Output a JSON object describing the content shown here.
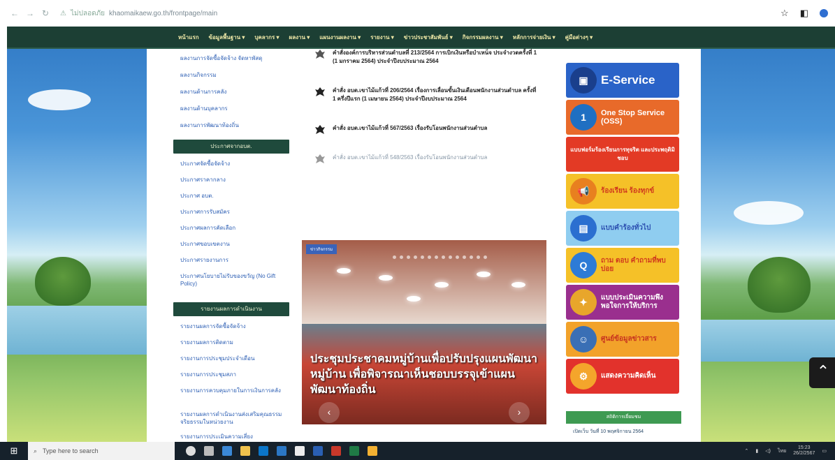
{
  "browser": {
    "back_icon": "back-arrow",
    "forward_icon": "forward-arrow",
    "reload_icon": "reload",
    "security_label": "ไม่ปลอดภัย",
    "url": "khaomaikaew.go.th/frontpage/main",
    "star_icon": "star",
    "extension_icon": "extension",
    "profile_icon": "profile"
  },
  "nav": {
    "items": [
      "หน้าแรก",
      "ข้อมูลพื้นฐาน ▾",
      "บุคลากร ▾",
      "ผลงาน ▾",
      "แผนงานผลงาน ▾",
      "รายงาน ▾",
      "ข่าวประชาสัมพันธ์ ▾",
      "กิจกรรมผลงาน ▾",
      "หลักการจ่ายเงิน ▾",
      "คู่มือต่างๆ ▾"
    ]
  },
  "left": {
    "links_top": [
      "ผลงานการจัดซื้อจัดจ้าง จัดหาพัสดุ",
      "ผลงานกิจกรรม",
      "ผลงานด้านการคลัง",
      "ผลงานด้านบุคลากร",
      "ผลงานการพัฒนาท้องถิ่น"
    ],
    "panel1_title": "ประกาศจากอบต.",
    "panel1_links": [
      "ประกาศจัดซื้อจัดจ้าง",
      "ประกาศราคากลาง",
      "ประกาศ อบต.",
      "ประกาศการรับสมัคร",
      "ประกาศผลการคัดเลือก",
      "ประกาศขอบเขตงาน",
      "ประกาศรายงานการ",
      "ประกาศนโยบายไม่รับของขวัญ (No Gift Policy)"
    ],
    "panel2_title": "รายงานผลการดำเนินงาน",
    "panel2_links": [
      "รายงานผลการจัดซื้อจัดจ้าง",
      "รายงานผลการติดตาม",
      "รายงานการประชุมประจำเดือน",
      "รายงานการประชุมสภา",
      "รายงานการควบคุมภายในการเงินการคลัง",
      "รายงานผลการดำเนินงานส่งเสริมคุณธรรม จริยธรรมในหน่วยงาน",
      "รายงานการประเมินความเสี่ยง"
    ]
  },
  "news": [
    {
      "text": "คำสั่งองค์การบริหารส่วนตำบลที่ 213/2564 การเบิกเงินหรือบำเหน็จ ประจำงวดครั้งที่ 1 (1 มกราคม 2564) ประจำปีงบประมาณ 2564",
      "style": "bold"
    },
    {
      "text": "คำสั่ง อบต.เขาไม้แก้วที่ 206/2564 เรื่องการเลื่อนขั้นเงินเดือนพนักงานส่วนตำบล ครั้งที่ 1 ครึ่งปีแรก (1 เมษายน 2564) ประจำปีงบประมาณ 2564",
      "style": "bold"
    },
    {
      "text": "คำสั่ง อบต.เขาไม้แก้วที่ 567/2563 เรื่องรับโอนพนักงานส่วนตำบล",
      "style": "bold"
    },
    {
      "text": "คำสั่ง อบต.เขาไม้แก้วที่ 548/2563 เรื่องรับโอนพนักงานส่วนตำบล",
      "style": "light"
    }
  ],
  "slider": {
    "tag": "ข่าวกิจกรรม",
    "title": "ประชุมประชาคมหมู่บ้านเพื่อปรับปรุงแผนพัฒนาหมู่บ้าน เพื่อพิจารณาเห็นชอบบรรจุเข้าแผนพัฒนาท้องถิ่น",
    "prev": "‹",
    "next": "›"
  },
  "banners": {
    "eservice": "E-Service",
    "oss_line1": "One Stop Service",
    "oss_line2": "(OSS)",
    "complaint": "แบบฟอร์มร้องเรียนการทุจริต และประพฤติมิชอบ",
    "grievance": "ร้องเรียน ร้องทุกข์",
    "manual": "แบบคำร้องทั่วไป",
    "qa": "ถาม ตอบ คำถามที่พบบ่อย",
    "survey": "แบบประเมินความพึงพอใจการให้บริการ",
    "center": "ศูนย์ข้อมูลข่าวสาร",
    "opinion": "แสดงความคิดเห็น"
  },
  "stats": {
    "title": "สถิติการเยี่ยมชม",
    "line": "เปิดเว็บ วันที่ 10 พฤศจิกายน 2564"
  },
  "taskbar": {
    "search_placeholder": "Type here to search",
    "time": "15:23",
    "date": "26/2/2567",
    "lang": "ไทย"
  }
}
